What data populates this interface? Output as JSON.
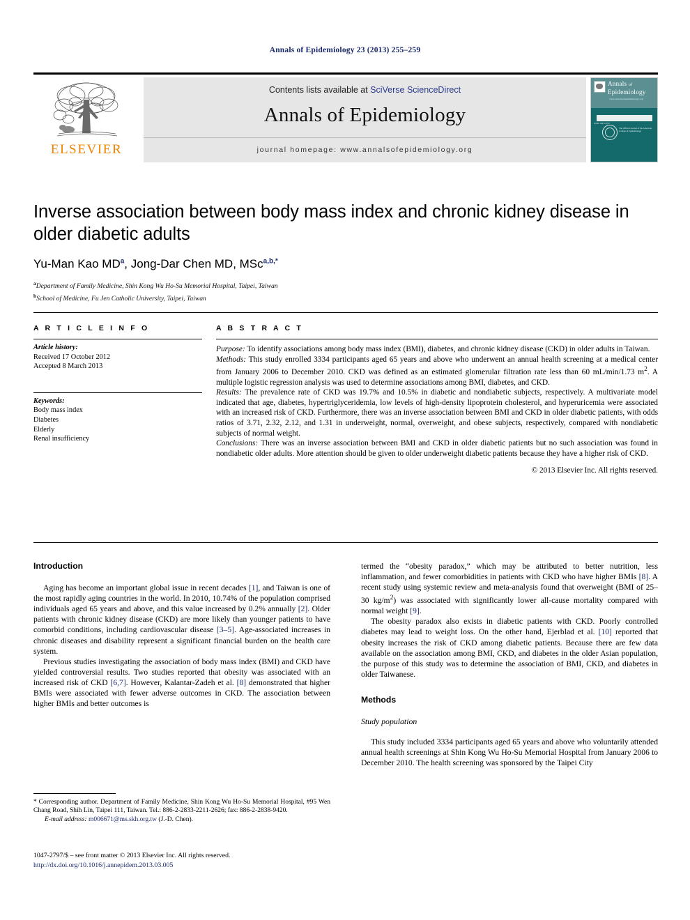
{
  "running_head": "Annals of Epidemiology 23 (2013) 255–259",
  "masthead": {
    "publisher_name": "ELSEVIER",
    "contents_prefix": "Contents lists available at ",
    "contents_link": "SciVerse ScienceDirect",
    "journal_title": "Annals of Epidemiology",
    "homepage_line": "journal homepage: www.annalsofepidemiology.org",
    "cover": {
      "line1": "Annals",
      "line2": "of",
      "line3": "Epidemiology",
      "url": "www.annalsofepidemiology.org",
      "issn": "ISSN 1047-2797",
      "seal_text": "The Official Journal of the American College of Epidemiology"
    }
  },
  "article": {
    "title": "Inverse association between body mass index and chronic kidney disease in older diabetic adults",
    "authors": [
      {
        "name": "Yu-Man Kao MD",
        "marks": "a"
      },
      {
        "name": "Jong-Dar Chen MD, MSc",
        "marks": "a,b,*"
      }
    ],
    "affiliations": [
      {
        "mark": "a",
        "text": "Department of Family Medicine, Shin Kong Wu Ho-Su Memorial Hospital, Taipei, Taiwan"
      },
      {
        "mark": "b",
        "text": "School of Medicine, Fu Jen Catholic University, Taipei, Taiwan"
      }
    ]
  },
  "article_info": {
    "heading": "A R T I C L E  I N F O",
    "history_label": "Article history:",
    "history": [
      "Received 17 October 2012",
      "Accepted 8 March 2013"
    ],
    "keywords_label": "Keywords:",
    "keywords": [
      "Body mass index",
      "Diabetes",
      "Elderly",
      "Renal insufficiency"
    ]
  },
  "abstract": {
    "heading": "A B S T R A C T",
    "sections": [
      {
        "label": "Purpose:",
        "text": " To identify associations among body mass index (BMI), diabetes, and chronic kidney disease (CKD) in older adults in Taiwan."
      },
      {
        "label": "Methods:",
        "text": " This study enrolled 3334 participants aged 65 years and above who underwent an annual health screening at a medical center from January 2006 to December 2010. CKD was defined as an estimated glomerular filtration rate less than 60 mL/min/1.73 m2. A multiple logistic regression analysis was used to determine associations among BMI, diabetes, and CKD."
      },
      {
        "label": "Results:",
        "text": " The prevalence rate of CKD was 19.7% and 10.5% in diabetic and nondiabetic subjects, respectively. A multivariate model indicated that age, diabetes, hypertriglyceridemia, low levels of high-density lipoprotein cholesterol, and hyperuricemia were associated with an increased risk of CKD. Furthermore, there was an inverse association between BMI and CKD in older diabetic patients, with odds ratios of 3.71, 2.32, 2.12, and 1.31 in underweight, normal, overweight, and obese subjects, respectively, compared with nondiabetic subjects of normal weight."
      },
      {
        "label": "Conclusions:",
        "text": " There was an inverse association between BMI and CKD in older diabetic patients but no such association was found in nondiabetic older adults. More attention should be given to older underweight diabetic patients because they have a higher risk of CKD."
      }
    ],
    "copyright": "© 2013 Elsevier Inc. All rights reserved."
  },
  "body": {
    "left_column": {
      "heading": "Introduction",
      "paragraph1_a": "Aging has become an important global issue in recent decades ",
      "paragraph1_ref1": "[1]",
      "paragraph1_b": ", and Taiwan is one of the most rapidly aging countries in the world. In 2010, 10.74% of the population comprised individuals aged 65 years and above, and this value increased by 0.2% annually ",
      "paragraph1_ref2": "[2]",
      "paragraph1_c": ". Older patients with chronic kidney disease (CKD) are more likely than younger patients to have comorbid conditions, including cardiovascular disease ",
      "paragraph1_ref3": "[3–5]",
      "paragraph1_d": ". Age-associated increases in chronic diseases and disability represent a significant financial burden on the health care system.",
      "paragraph2_a": "Previous studies investigating the association of body mass index (BMI) and CKD have yielded controversial results. Two studies reported that obesity was associated with an increased risk of CKD ",
      "paragraph2_ref1": "[6,7]",
      "paragraph2_b": ". However, Kalantar-Zadeh et al. ",
      "paragraph2_ref2": "[8]",
      "paragraph2_c": " demonstrated that higher BMIs were associated with fewer adverse outcomes in CKD. The association between higher BMIs and better outcomes is"
    },
    "right_column": {
      "paragraph1_a": "termed the “obesity paradox,” which may be attributed to better nutrition, less inflammation, and fewer comorbidities in patients with CKD who have higher BMIs ",
      "paragraph1_ref1": "[8]",
      "paragraph1_b": ". A recent study using systemic review and meta-analysis found that overweight (BMI of 25–30 kg/m2) was associated with significantly lower all-cause mortality compared with normal weight ",
      "paragraph1_ref2": "[9]",
      "paragraph1_c": ".",
      "paragraph2_a": "The obesity paradox also exists in diabetic patients with CKD. Poorly controlled diabetes may lead to weight loss. On the other hand, Ejerblad et al. ",
      "paragraph2_ref1": "[10]",
      "paragraph2_b": " reported that obesity increases the risk of CKD among diabetic patients. Because there are few data available on the association among BMI, CKD, and diabetes in the older Asian population, the purpose of this study was to determine the association of BMI, CKD, and diabetes in older Taiwanese.",
      "methods_heading": "Methods",
      "subheading": "Study population",
      "paragraph3": "This study included 3334 participants aged 65 years and above who voluntarily attended annual health screenings at Shin Kong Wu Ho-Su Memorial Hospital from January 2006 to December 2010. The health screening was sponsored by the Taipei City"
    }
  },
  "footnote": {
    "corresponding": "* Corresponding author. Department of Family Medicine, Shin Kong Wu Ho-Su Memorial Hospital, #95 Wen Chang Road, Shih Lin, Taipei 111, Taiwan. Tel.: 886-2-2833-2211-2626; fax: 886-2-2838-9420.",
    "email_label": "E-mail address:",
    "email": "m006671@ms.skh.org.tw",
    "email_suffix": "(J.-D. Chen).",
    "imprint_line1": "1047-2797/$ – see front matter © 2013 Elsevier Inc. All rights reserved.",
    "imprint_doi": "http://dx.doi.org/10.1016/j.annepidem.2013.03.005"
  },
  "colors": {
    "link": "#1a2a6c",
    "elsevier_orange": "#ef8200",
    "band_gray": "#e6e6e6",
    "cover_teal_light": "#5c8f92",
    "cover_teal_dark": "#14696b"
  }
}
